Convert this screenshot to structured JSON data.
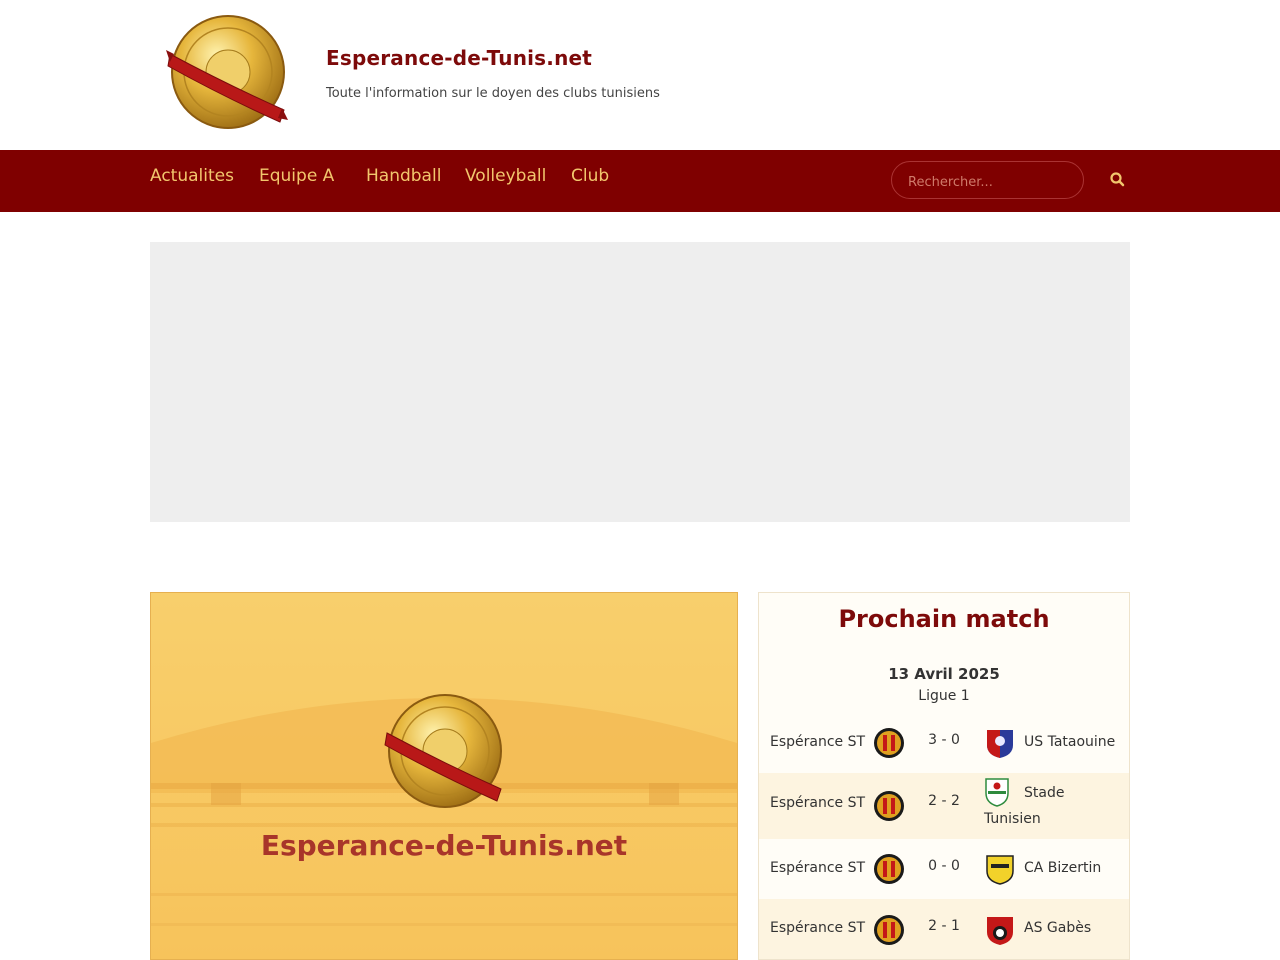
{
  "header": {
    "site_title": "Esperance-de-Tunis.net",
    "tagline": "Toute l'information sur le doyen des clubs tunisiens"
  },
  "nav": {
    "items": [
      {
        "label": "Actualites"
      },
      {
        "label": "Equipe A"
      },
      {
        "label": "Handball"
      },
      {
        "label": "Volleyball"
      },
      {
        "label": "Club"
      }
    ],
    "search_placeholder": "Rechercher...",
    "search_icon": "search-icon"
  },
  "colors": {
    "brand_dark_red": "#7f0000",
    "nav_text_gold": "#f2c66d",
    "title_red": "#7d0a0a",
    "feature_orange": "#f7c35b"
  },
  "feature": {
    "title": "Esperance-de-Tunis.net"
  },
  "sidebar": {
    "widget_title": "Prochain match",
    "date": "13 Avril 2025",
    "competition": "Ligue 1",
    "matches": [
      {
        "home": "Espérance ST",
        "score": "3 - 0",
        "away": "US Tataouine"
      },
      {
        "home": "Espérance ST",
        "score": "2 - 2",
        "away": "Stade Tunisien"
      },
      {
        "home": "Espérance ST",
        "score": "0 - 0",
        "away": "CA Bizertin"
      },
      {
        "home": "Espérance ST",
        "score": "2 - 1",
        "away": "AS Gabès"
      }
    ]
  }
}
